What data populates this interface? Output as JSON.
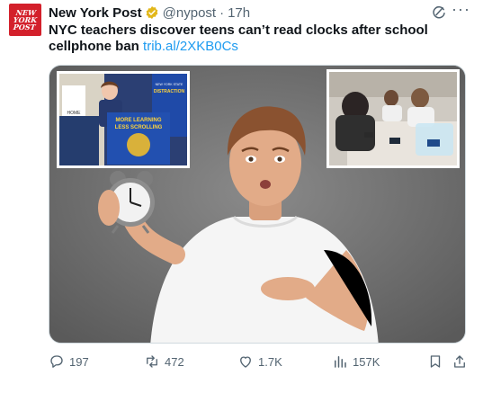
{
  "post": {
    "author_name": "New York Post",
    "handle": "@nypost",
    "separator": "·",
    "time": "17h",
    "avatar_logo": [
      "NEW",
      "YORK",
      "POST"
    ],
    "text": "NYC teachers discover teens can’t read clocks after school cellphone ban",
    "link": "trib.al/2XKB0Cs"
  },
  "media": {
    "inset_left_text": {
      "sign_top": "NEW YORK STATE",
      "sign_word": "DISTRACTION",
      "podium_banner_line1": "MORE LEARNING",
      "podium_banner_line2": "LESS SCROLLING",
      "poster_word": "HOME"
    }
  },
  "actions": {
    "replies": "197",
    "reposts": "472",
    "likes": "1.7K",
    "views": "157K"
  },
  "icons": {
    "verified": "verified-badge-icon",
    "grok": "grok-icon",
    "more": "more-icon",
    "reply": "reply-icon",
    "repost": "repost-icon",
    "like": "like-icon",
    "views": "views-icon",
    "bookmark": "bookmark-icon",
    "share": "share-icon"
  },
  "colors": {
    "brand_red": "#d3202b",
    "link_blue": "#1d9bf0",
    "verified_gold": "#e2b719",
    "muted_text": "#536471"
  }
}
